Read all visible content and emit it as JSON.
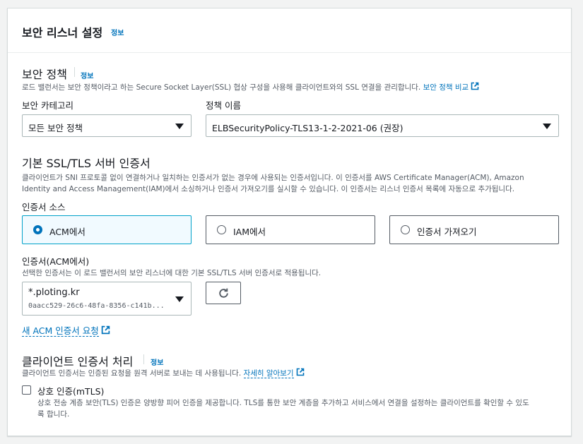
{
  "panel": {
    "title": "보안 리스너 설정",
    "info": "정보"
  },
  "policy": {
    "title": "보안 정책",
    "info": "정보",
    "description": "로드 밸런서는 보안 정책이라고 하는 Secure Socket Layer(SSL) 협상 구성을 사용해 클라이언트와의 SSL 연결을 관리합니다.",
    "compare_link": "보안 정책 비교",
    "category_label": "보안 카테고리",
    "category_value": "모든 보안 정책",
    "name_label": "정책 이름",
    "name_value": "ELBSecurityPolicy-TLS13-1-2-2021-06 (권장)"
  },
  "certificate": {
    "title": "기본 SSL/TLS 서버 인증서",
    "description_line1": "클라이언트가 SNI 프로토콜 없이 연결하거나 일치하는 인증서가 없는 경우에 사용되는 인증서입니다. 이 인증서를 AWS Certificate Manager(ACM), Amazon",
    "description_line2": "Identity and Access Management(IAM)에서 소싱하거나 인증서 가져오기를 실시할 수 있습니다. 이 인증서는 리스너 인증서 목록에 자동으로 추가됩니다.",
    "source_label": "인증서 소스",
    "sources": [
      {
        "label": "ACM에서",
        "selected": true
      },
      {
        "label": "IAM에서",
        "selected": false
      },
      {
        "label": "인증서 가져오기",
        "selected": false
      }
    ],
    "acm_label": "인증서(ACM에서)",
    "acm_description": "선택한 인증서는 이 로드 밸런서의 보안 리스너에 대한 기본 SSL/TLS 서버 인증서로 적용됩니다.",
    "acm_value": "*.ploting.kr",
    "acm_sub": "0aacc529-26c6-48fa-8356-c141b...",
    "request_link": "새 ACM 인증서 요청"
  },
  "client_cert": {
    "title": "클라이언트 인증서 처리",
    "info": "정보",
    "description": "클라이언트 인증서는 인증된 요청을 원격 서버로 보내는 데 사용됩니다.",
    "learn_more": "자세히 알아보기",
    "mtls_label": "상호 인증(mTLS)",
    "mtls_checked": false,
    "mtls_description_line1": "상호 전송 계층 보안(TLS) 인증은 양방향 피어 인증을 제공합니다. TLS를 통한 보안 계층을 추가하고 서비스에서 연결을 설정하는 클라이언트를 확인할 수 있도",
    "mtls_description_line2": "록 합니다."
  },
  "colors": {
    "link": "#0073bb",
    "selected_border": "#00a1c9",
    "selected_bg": "#f1faff",
    "text": "#16191f",
    "muted": "#545b64"
  }
}
